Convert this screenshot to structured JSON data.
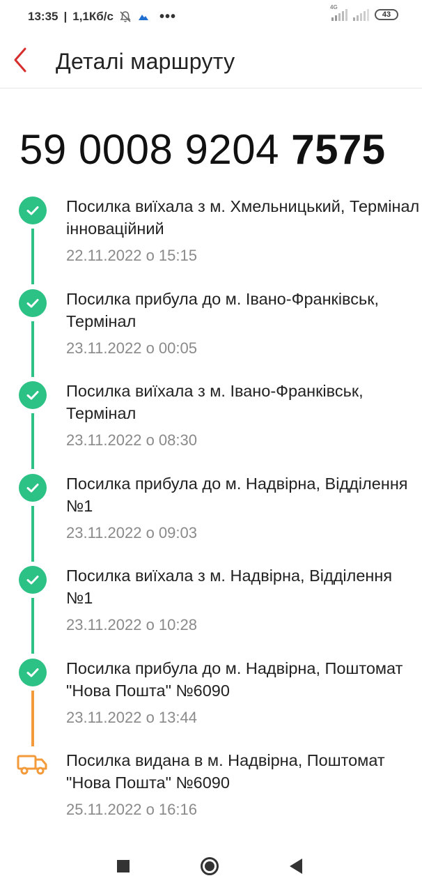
{
  "status_bar": {
    "time": "13:35",
    "speed": "1,1Кб/с",
    "network_label": "4G",
    "battery": "43",
    "icons": [
      "mute-icon",
      "cloud-icon",
      "more-dots-icon",
      "signal-icon",
      "signal-icon",
      "battery-icon"
    ]
  },
  "header": {
    "title": "Деталі маршруту",
    "back_icon": "chevron-left-icon",
    "accent_color": "#d62d2d"
  },
  "tracking": {
    "prefix": "59 0008 9204 ",
    "suffix": "7575"
  },
  "colors": {
    "done": "#2cc185",
    "in_progress": "#f39a3a"
  },
  "events": [
    {
      "status": "done",
      "text": "Посилка виїхала з м. Хмельницький, Термінал інноваційний",
      "date": "22.11.2022 о 15:15"
    },
    {
      "status": "done",
      "text": "Посилка прибула до м. Івано-Франківськ, Термінал",
      "date": "23.11.2022 о 00:05"
    },
    {
      "status": "done",
      "text": "Посилка виїхала з м. Івано-Франківськ, Термінал",
      "date": "23.11.2022 о 08:30"
    },
    {
      "status": "done",
      "text": "Посилка прибула до м. Надвірна, Відділення №1",
      "date": "23.11.2022 о 09:03"
    },
    {
      "status": "done",
      "text": "Посилка виїхала з м. Надвірна, Відділення №1",
      "date": "23.11.2022 о 10:28"
    },
    {
      "status": "done",
      "text": "Посилка прибула до м. Надвірна, Поштомат \"Нова Пошта\" №6090",
      "date": "23.11.2022 о 13:44"
    },
    {
      "status": "delivery",
      "text": "Посилка видана в м. Надвірна, Поштомат \"Нова Пошта\" №6090",
      "date": "25.11.2022 о 16:16"
    }
  ],
  "nav": {
    "icons": [
      "recent-apps-icon",
      "home-icon",
      "back-icon"
    ]
  }
}
